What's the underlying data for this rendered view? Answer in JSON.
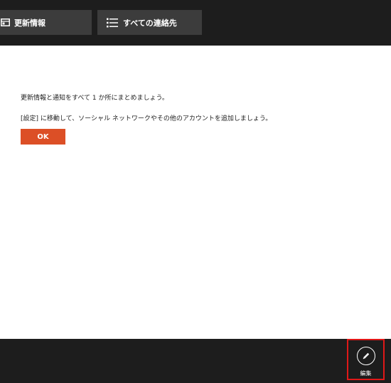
{
  "top_nav": {
    "updates_label": "更新情報",
    "updates_icon": "panel-layout-icon",
    "contacts_label": "すべての連絡先",
    "contacts_icon": "list-icon"
  },
  "main": {
    "message_1": "更新情報と通知をすべて 1 か所にまとめましょう。",
    "message_2": "[設定] に移動して、ソーシャル ネットワークやその他のアカウントを追加しましょう。",
    "ok_label": "OK"
  },
  "app_bar": {
    "edit_label": "編集",
    "edit_icon": "pencil-icon"
  },
  "colors": {
    "bar_background": "#1d1d1d",
    "nav_button": "#3c3c3c",
    "accent": "#dc4f26",
    "highlight_border": "#e01818"
  }
}
